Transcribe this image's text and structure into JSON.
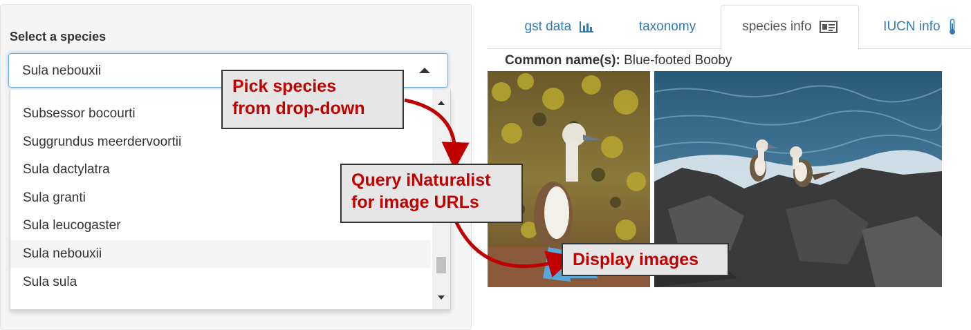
{
  "sidebar": {
    "label": "Select a species",
    "selected_value": "Sula nebouxii",
    "options": [
      "Subsessor bocourti",
      "Suggrundus meerdervoortii",
      "Sula dactylatra",
      "Sula granti",
      "Sula leucogaster",
      "Sula nebouxii",
      "Sula sula"
    ]
  },
  "tabs": [
    {
      "label": "gst data",
      "icon": "bar-chart-icon"
    },
    {
      "label": "taxonomy",
      "icon": ""
    },
    {
      "label": "species info",
      "icon": "id-card-icon",
      "active": true
    },
    {
      "label": "IUCN info",
      "icon": "thermometer-icon"
    }
  ],
  "species_info": {
    "common_label": "Common name(s):",
    "common_value": "Blue-footed Booby"
  },
  "annotations": {
    "pick": [
      "Pick species",
      "from drop-down"
    ],
    "query": [
      "Query iNaturalist",
      "for image URLs"
    ],
    "display": "Display images"
  },
  "colors": {
    "annotation_text": "#c00000",
    "arrow": "#c00000",
    "focus_border": "#66afe9",
    "tab_link": "#337ab7"
  }
}
